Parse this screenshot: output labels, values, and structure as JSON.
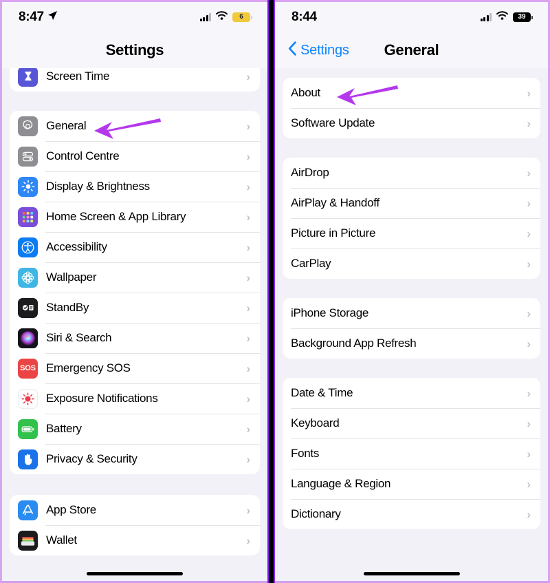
{
  "accent": {
    "arrow": "#b438ec",
    "link": "#0a84ff",
    "page_bg": "#f2f1f7",
    "card": "#ffffff",
    "frame": "#d9a4f2"
  },
  "left_phone": {
    "status": {
      "time": "8:47",
      "location_icon": "location-arrow-icon",
      "cellular_icon": "cellular-bars-icon",
      "wifi_icon": "wifi-icon",
      "battery_icon": "battery-icon",
      "battery_level": "6"
    },
    "nav": {
      "title": "Settings"
    },
    "groups": [
      {
        "rows": [
          {
            "label": "Screen Time",
            "icon": "screen-time-icon"
          }
        ]
      },
      {
        "rows": [
          {
            "label": "General",
            "icon": "general-gear-icon"
          },
          {
            "label": "Control Centre",
            "icon": "control-centre-icon"
          },
          {
            "label": "Display & Brightness",
            "icon": "display-brightness-icon"
          },
          {
            "label": "Home Screen & App Library",
            "icon": "home-screen-icon"
          },
          {
            "label": "Accessibility",
            "icon": "accessibility-icon"
          },
          {
            "label": "Wallpaper",
            "icon": "wallpaper-icon"
          },
          {
            "label": "StandBy",
            "icon": "standby-icon"
          },
          {
            "label": "Siri & Search",
            "icon": "siri-icon"
          },
          {
            "label": "Emergency SOS",
            "icon": "emergency-sos-icon"
          },
          {
            "label": "Exposure Notifications",
            "icon": "exposure-notifications-icon"
          },
          {
            "label": "Battery",
            "icon": "battery-settings-icon"
          },
          {
            "label": "Privacy & Security",
            "icon": "privacy-security-icon"
          }
        ]
      },
      {
        "rows": [
          {
            "label": "App Store",
            "icon": "app-store-icon"
          },
          {
            "label": "Wallet",
            "icon": "wallet-icon"
          }
        ]
      }
    ],
    "annotation": {
      "target": "General",
      "arrow_icon": "pointing-arrow-icon"
    }
  },
  "right_phone": {
    "status": {
      "time": "8:44",
      "cellular_icon": "cellular-bars-icon",
      "wifi_icon": "wifi-icon",
      "battery_icon": "battery-icon",
      "battery_level": "39"
    },
    "nav": {
      "back_label": "Settings",
      "back_icon": "chevron-left-icon",
      "title": "General"
    },
    "groups": [
      {
        "rows": [
          {
            "label": "About"
          },
          {
            "label": "Software Update"
          }
        ]
      },
      {
        "rows": [
          {
            "label": "AirDrop"
          },
          {
            "label": "AirPlay & Handoff"
          },
          {
            "label": "Picture in Picture"
          },
          {
            "label": "CarPlay"
          }
        ]
      },
      {
        "rows": [
          {
            "label": "iPhone Storage"
          },
          {
            "label": "Background App Refresh"
          }
        ]
      },
      {
        "rows": [
          {
            "label": "Date & Time"
          },
          {
            "label": "Keyboard"
          },
          {
            "label": "Fonts"
          },
          {
            "label": "Language & Region"
          },
          {
            "label": "Dictionary"
          }
        ]
      }
    ],
    "annotation": {
      "target": "About",
      "arrow_icon": "pointing-arrow-icon"
    }
  },
  "chevron_glyph": "›"
}
